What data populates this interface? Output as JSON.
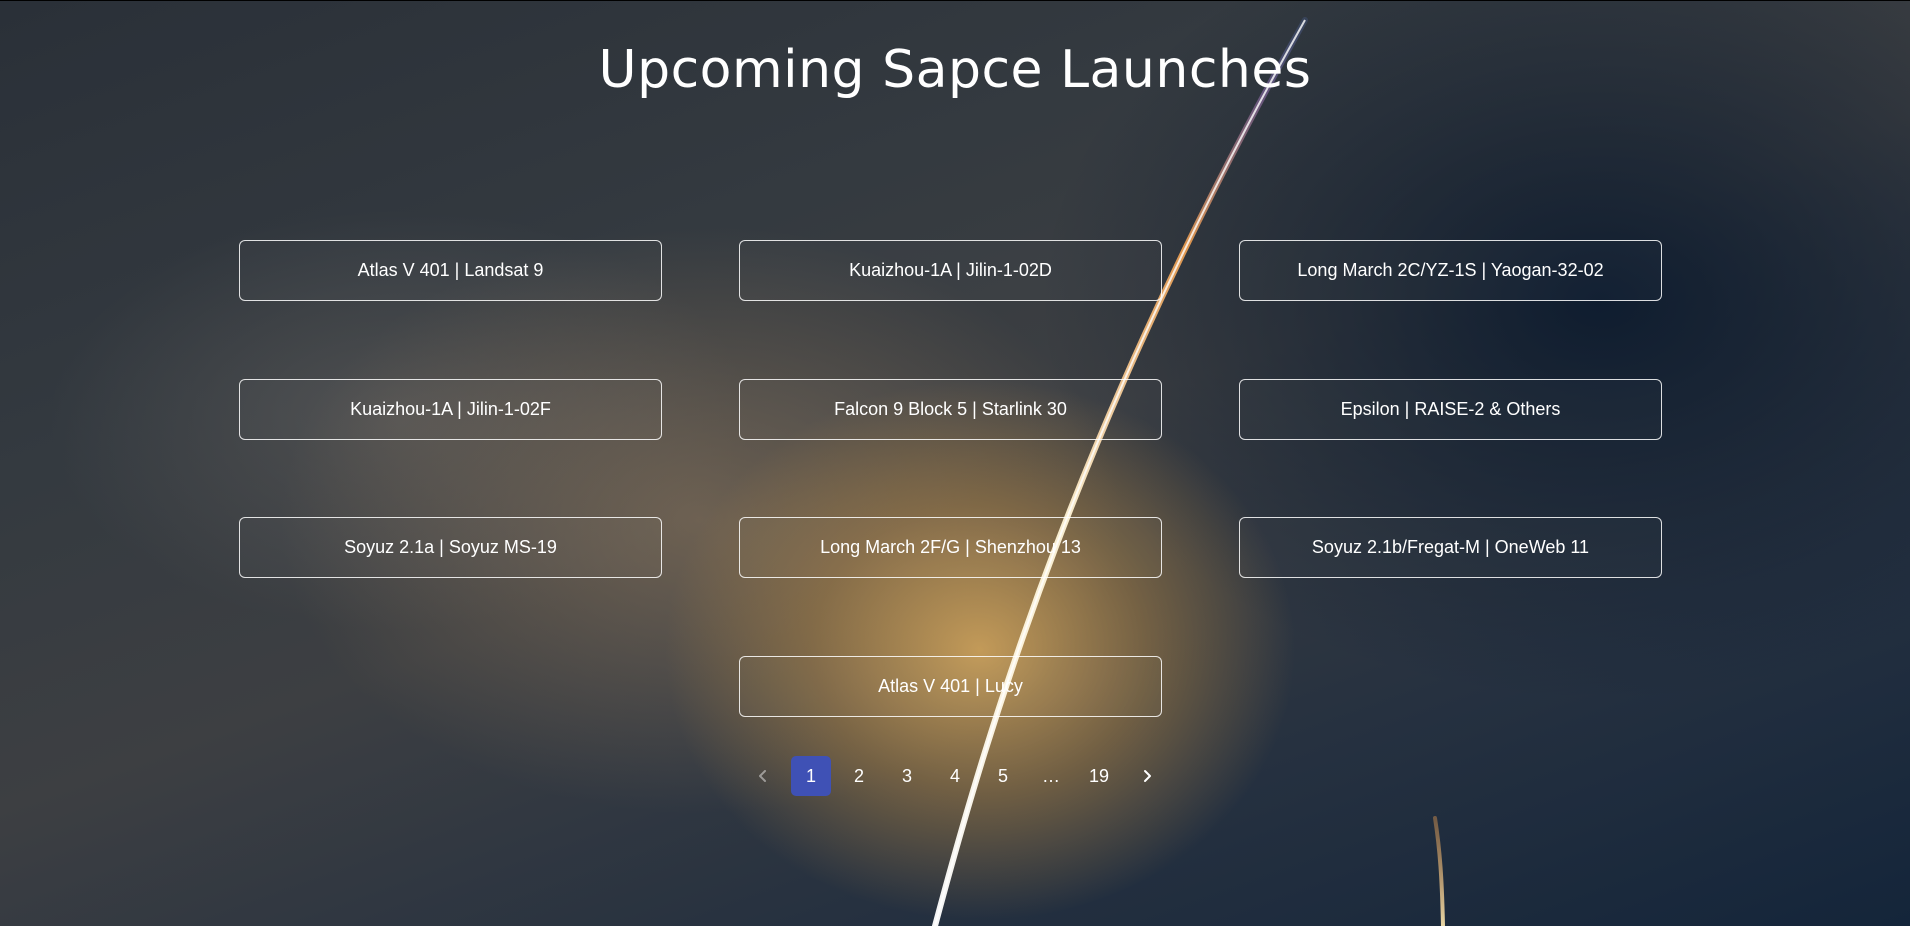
{
  "page": {
    "title": "Upcoming Sapce Launches"
  },
  "launches": [
    "Atlas V 401 | Landsat 9",
    "Kuaizhou-1A | Jilin-1-02D",
    "Long March 2C/YZ-1S | Yaogan-32-02",
    "Kuaizhou-1A | Jilin-1-02F",
    "Falcon 9 Block 5 | Starlink 30",
    "Epsilon | RAISE-2 & Others",
    "Soyuz 2.1a | Soyuz MS-19",
    "Long March 2F/G | Shenzhou 13",
    "Soyuz 2.1b/Fregat-M | OneWeb 11",
    "Atlas V 401 | Lucy"
  ],
  "pagination": {
    "current": "1",
    "pages": [
      "1",
      "2",
      "3",
      "4",
      "5"
    ],
    "ellipsis": "…",
    "last": "19",
    "prev_icon": "chevron-left-icon",
    "next_icon": "chevron-right-icon"
  },
  "colors": {
    "active_page": "#3f51b5",
    "text": "#ffffff"
  }
}
